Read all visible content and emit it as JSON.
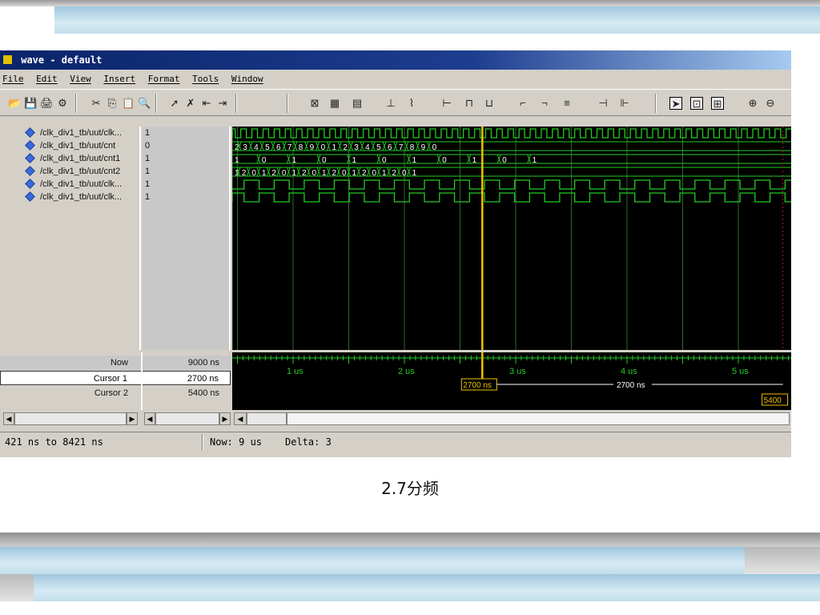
{
  "window": {
    "title": "wave - default",
    "menu": [
      "File",
      "Edit",
      "View",
      "Insert",
      "Format",
      "Tools",
      "Window"
    ],
    "toolbar_icons": [
      "open-icon",
      "save-icon",
      "print-icon",
      "properties-icon",
      "cut-icon",
      "copy-icon",
      "paste-icon",
      "find-icon",
      "select-icon",
      "delete-icon",
      "expand-icon",
      "collapse-icon",
      "zoom-in-icon",
      "zoom-out-icon"
    ]
  },
  "signals": [
    {
      "name": "/clk_div1_tb/uut/clk...",
      "value": "1"
    },
    {
      "name": "/clk_div1_tb/uut/cnt",
      "value": "0"
    },
    {
      "name": "/clk_div1_tb/uut/cnt1",
      "value": "1"
    },
    {
      "name": "/clk_div1_tb/uut/cnt2",
      "value": "1"
    },
    {
      "name": "/clk_div1_tb/uut/clk...",
      "value": "1"
    },
    {
      "name": "/clk_div1_tb/uut/clk...",
      "value": "1"
    }
  ],
  "wave_labels": {
    "cnt": [
      "2",
      "3",
      "4",
      "5",
      "6",
      "7",
      "8",
      "9",
      "0",
      "1",
      "2",
      "3",
      "4",
      "5",
      "6",
      "7",
      "8",
      "9",
      "0"
    ],
    "cnt1": [
      "1",
      "0",
      "1",
      "0",
      "1",
      "0",
      "1",
      "0",
      "1",
      "0",
      "1"
    ],
    "cnt2": [
      "1",
      "2",
      "0",
      "1",
      "2",
      "0",
      "1",
      "2",
      "0",
      "1",
      "2",
      "0",
      "1",
      "2",
      "0",
      "1",
      "2",
      "0",
      "1"
    ]
  },
  "cursors": {
    "now_label": "Now",
    "now_value": "9000 ns",
    "cursor1_label": "Cursor 1",
    "cursor1_value": "2700 ns",
    "cursor2_label": "Cursor 2",
    "cursor2_value": "5400 ns",
    "cursor1_marker": "2700 ns",
    "delta_marker": "2700 ns",
    "cursor2_marker": "5400"
  },
  "timeline": {
    "ticks": [
      "1 us",
      "2 us",
      "3 us",
      "4 us",
      "5 us"
    ]
  },
  "status": {
    "range": "421 ns to 8421 ns",
    "now": "Now: 9 us",
    "delta": "Delta: 3"
  },
  "caption": "2.7分频",
  "colors": {
    "wave": "#22cc22",
    "cursor": "#f0c000",
    "grid": "#2a6a2a"
  }
}
